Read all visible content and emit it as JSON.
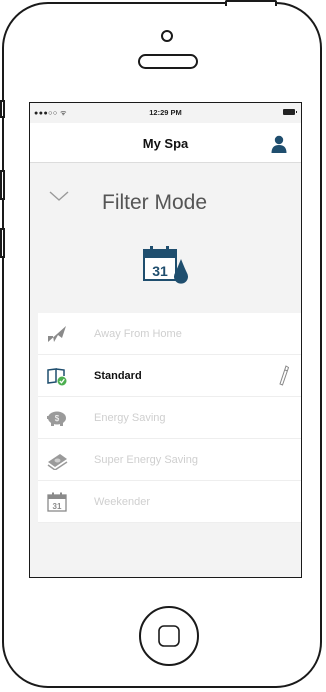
{
  "status_bar": {
    "carrier": "●●●○○ ᯤ",
    "time": "12:29 PM"
  },
  "nav": {
    "title": "My Spa",
    "user_icon": "user-icon"
  },
  "header": {
    "title": "Filter Mode",
    "calendar_day": "31"
  },
  "modes": [
    {
      "label": "Away From Home",
      "icon": "airplane-icon",
      "active": false
    },
    {
      "label": "Standard",
      "icon": "standard-icon",
      "active": true
    },
    {
      "label": "Energy Saving",
      "icon": "piggy-bank-icon",
      "active": false
    },
    {
      "label": "Super Energy Saving",
      "icon": "money-stack-icon",
      "active": false
    },
    {
      "label": "Weekender",
      "icon": "calendar-icon",
      "active": false,
      "day": "31"
    }
  ],
  "colors": {
    "accent": "#1f4e6e",
    "check": "#4caf50",
    "inactive_text": "#cfcfcf"
  }
}
